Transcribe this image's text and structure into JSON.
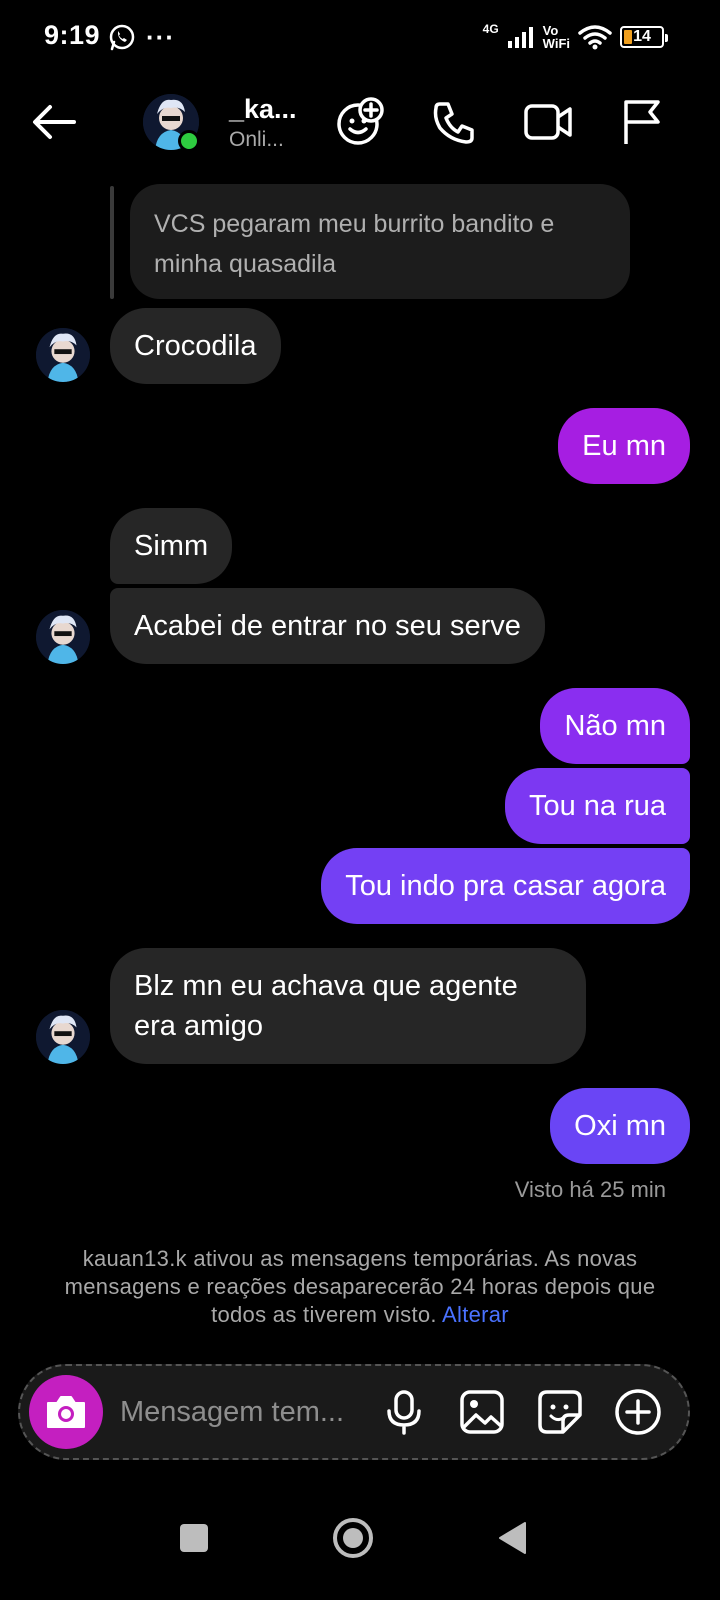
{
  "status_bar": {
    "time": "9:19",
    "network": "4G",
    "volte_top": "Vo",
    "volte_bottom": "WiFi",
    "battery_level": "14",
    "icons": [
      "whatsapp-icon",
      "more-dots-icon",
      "signal-icon",
      "wifi-icon",
      "battery-icon"
    ]
  },
  "header": {
    "name": "_ka...",
    "status": "Onli...",
    "icons": [
      "back-arrow-icon",
      "add-emoji-icon",
      "phone-icon",
      "video-icon",
      "flag-icon"
    ]
  },
  "messages": {
    "reply_preview": "VCS pegaram meu burrito bandito e minha quasadila",
    "m1": "Crocodila",
    "m2": "Eu mn",
    "m3": "Simm",
    "m4": "Acabei de entrar no seu serve",
    "m5": "Não mn",
    "m6": "Tou na rua",
    "m7": "Tou indo pra casar agora",
    "m8_line1": "Blz mn eu achava que agente",
    "m8_line2": "era amigo",
    "m9": "Oxi mn"
  },
  "seen_text": "Visto há 25 min",
  "notice": {
    "text": "kauan13.k ativou as mensagens temporárias. As novas mensagens e reações desaparecerão 24 horas depois que todos as tiverem visto.",
    "link": "Alterar"
  },
  "composer": {
    "placeholder": "Mensagem tem...",
    "icons": [
      "camera-icon",
      "microphone-icon",
      "gallery-icon",
      "sticker-icon",
      "plus-icon"
    ]
  },
  "colors": {
    "bubble_in": "#262626",
    "bubble_out_magenta": "#a81ee0",
    "bubble_out_violet": "#7a3af0",
    "bubble_out_indigo": "#6a45f5",
    "camera_button": "#c41fc0",
    "link": "#4a72ff",
    "online": "#2ecc40"
  }
}
